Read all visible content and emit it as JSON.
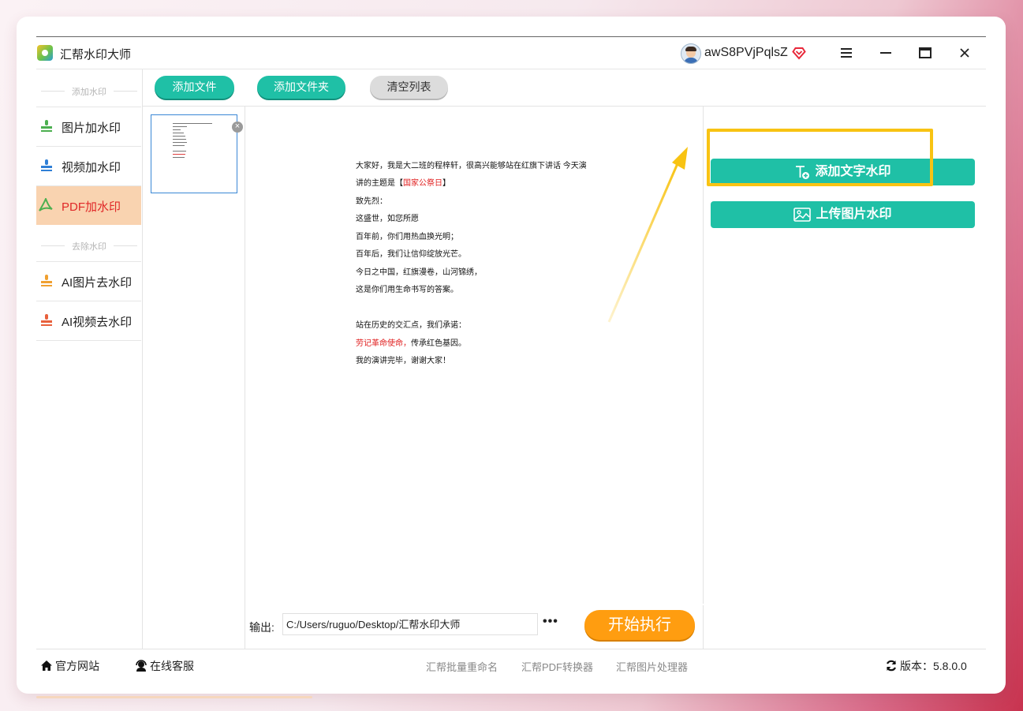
{
  "window": {
    "app_title": "汇帮水印大师",
    "user_name": "awS8PVjPqlsZ"
  },
  "sidebar": {
    "section_add": "添加水印",
    "section_remove": "去除水印",
    "items": [
      {
        "label": "图片加水印",
        "icon": "image-stamp-icon",
        "color": "#4caf50"
      },
      {
        "label": "视频加水印",
        "icon": "video-stamp-icon",
        "color": "#2f7fd6"
      },
      {
        "label": "PDF加水印",
        "icon": "pdf-icon",
        "color": "#4caf50",
        "active": true
      },
      {
        "label": "AI图片去水印",
        "icon": "ai-image-stamp-icon",
        "color": "#f0a030"
      },
      {
        "label": "AI视频去水印",
        "icon": "ai-video-stamp-icon",
        "color": "#e8603c"
      }
    ]
  },
  "toolbar": {
    "add_file": "添加文件",
    "add_folder": "添加文件夹",
    "clear_list": "清空列表"
  },
  "preview": {
    "lines": [
      {
        "t": "大家好，我是大二班的程梓轩，很高兴能够站在红旗下讲话 今天演"
      },
      {
        "a": "讲的主题是【",
        "r": "国家公祭日",
        "b": "】"
      },
      {
        "t": "致先烈："
      },
      {
        "t": "这盛世，如您所愿"
      },
      {
        "t": "百年前，你们用热血换光明；"
      },
      {
        "t": "百年后，我们让信仰绽放光芒。"
      },
      {
        "t": "今日之中国，红旗漫卷，山河锦绣，"
      },
      {
        "t": "这是你们用生命书写的答案。"
      },
      {
        "t": "站在历史的交汇点，我们承诺："
      },
      {
        "r": "劳记革命使命，",
        "b": "传承红色基因。"
      },
      {
        "t": "我的演讲完毕，谢谢大家！"
      }
    ]
  },
  "output": {
    "label": "输出:",
    "path": "C:/Users/ruguo/Desktop/汇帮水印大师",
    "more": "•••",
    "start": "开始执行"
  },
  "right_panel": {
    "add_text_watermark": "添加文字水印",
    "upload_image_watermark": "上传图片水印",
    "highlight_color": "#f8c313",
    "accent_color": "#1fc0a6"
  },
  "footer": {
    "website": "官方网站",
    "support": "在线客服",
    "links": [
      "汇帮批量重命名",
      "汇帮PDF转换器",
      "汇帮图片处理器"
    ],
    "version_label": "版本：",
    "version": "5.8.0.0"
  }
}
